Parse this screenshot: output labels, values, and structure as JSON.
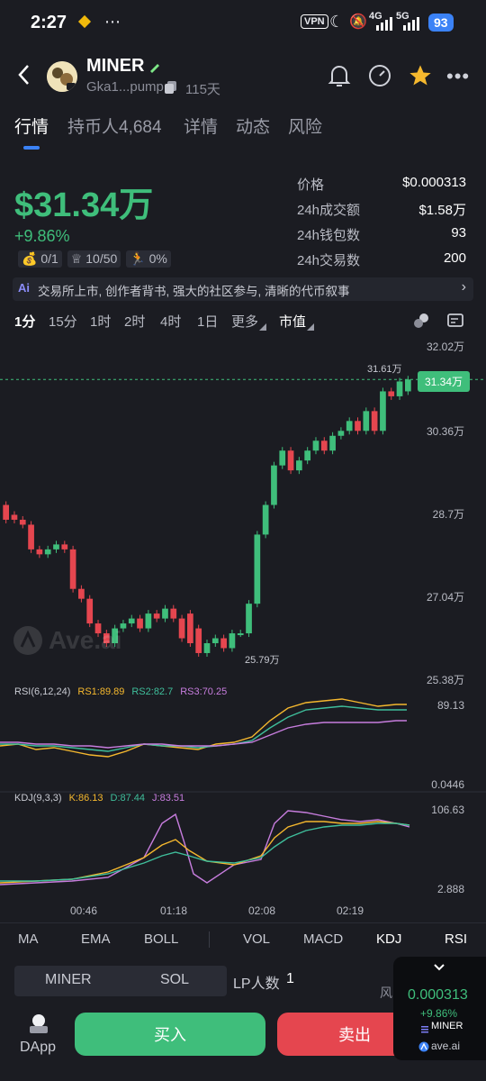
{
  "status_bar": {
    "time": "2:27",
    "vpn": "VPN",
    "signal_4g": "4G",
    "signal_5g": "5G",
    "battery": "93"
  },
  "header": {
    "title": "MINER",
    "address": "Gka1...pump",
    "age": "115天"
  },
  "tabs": [
    {
      "label": "行情"
    },
    {
      "label": "持币人4,684"
    },
    {
      "label": "详情"
    },
    {
      "label": "动态"
    },
    {
      "label": "风险"
    }
  ],
  "summary": {
    "market_cap": "$31.34万",
    "change": "+9.86%",
    "badges": [
      "0/1",
      "10/50",
      "0%"
    ],
    "stats": [
      {
        "label": "价格",
        "value": "$0.000313"
      },
      {
        "label": "24h成交额",
        "value": "$1.58万"
      },
      {
        "label": "24h钱包数",
        "value": "93"
      },
      {
        "label": "24h交易数",
        "value": "200"
      }
    ],
    "ai_text": "交易所上市, 创作者背书, 强大的社区参与, 清晰的代币叙事"
  },
  "timeframes": [
    "1分",
    "15分",
    "1时",
    "2时",
    "4时",
    "1日",
    "更多",
    "市值"
  ],
  "chart": {
    "y_ticks": [
      "32.02万",
      "30.36万",
      "28.7万",
      "27.04万",
      "25.38万"
    ],
    "current_label": "31.34万",
    "high_label": "31.61万",
    "low_label": "25.79万",
    "watermark": "Ave.ai",
    "x_ticks": [
      "00:46",
      "01:18",
      "02:08",
      "02:19"
    ],
    "rsi_label": "RSI(6,12,24)",
    "rsi_values": [
      "RS1:89.89",
      "RS2:82.7",
      "RS3:70.25"
    ],
    "rsi_axis": [
      "89.13",
      "0.0446"
    ],
    "kdj_label": "KDJ(9,3,3)",
    "kdj_values": [
      "K:86.13",
      "D:87.44",
      "J:83.51"
    ],
    "kdj_axis": [
      "106.63",
      "2.888"
    ]
  },
  "chart_data": {
    "type": "candlestick",
    "unit": "万",
    "ylim": [
      25.38,
      32.02
    ],
    "candles": [
      {
        "o": 28.8,
        "c": 28.5
      },
      {
        "o": 28.6,
        "c": 28.5
      },
      {
        "o": 28.5,
        "c": 28.4
      },
      {
        "o": 28.4,
        "c": 27.9
      },
      {
        "o": 27.9,
        "c": 27.8
      },
      {
        "o": 27.8,
        "c": 27.9
      },
      {
        "o": 27.9,
        "c": 28.0
      },
      {
        "o": 28.0,
        "c": 27.9
      },
      {
        "o": 27.9,
        "c": 27.1
      },
      {
        "o": 27.1,
        "c": 26.9
      },
      {
        "o": 26.9,
        "c": 26.4
      },
      {
        "o": 26.4,
        "c": 26.2
      },
      {
        "o": 26.2,
        "c": 26.0
      },
      {
        "o": 26.0,
        "c": 26.3
      },
      {
        "o": 26.3,
        "c": 26.4
      },
      {
        "o": 26.4,
        "c": 26.5
      },
      {
        "o": 26.5,
        "c": 26.3
      },
      {
        "o": 26.3,
        "c": 26.6
      },
      {
        "o": 26.6,
        "c": 26.5
      },
      {
        "o": 26.5,
        "c": 26.7
      },
      {
        "o": 26.7,
        "c": 26.5
      },
      {
        "o": 26.5,
        "c": 26.1
      },
      {
        "o": 26.6,
        "c": 26.0
      },
      {
        "o": 26.3,
        "c": 25.8
      },
      {
        "o": 25.8,
        "c": 26.0
      },
      {
        "o": 26.0,
        "c": 26.1
      },
      {
        "o": 26.1,
        "c": 25.9
      },
      {
        "o": 25.9,
        "c": 26.2
      },
      {
        "o": 26.2,
        "c": 26.2
      },
      {
        "o": 26.2,
        "c": 26.8
      },
      {
        "o": 26.8,
        "c": 28.2
      },
      {
        "o": 28.2,
        "c": 28.8
      },
      {
        "o": 28.8,
        "c": 29.6
      },
      {
        "o": 29.6,
        "c": 29.9
      },
      {
        "o": 29.9,
        "c": 29.5
      },
      {
        "o": 29.5,
        "c": 29.7
      },
      {
        "o": 29.7,
        "c": 29.9
      },
      {
        "o": 29.9,
        "c": 30.1
      },
      {
        "o": 30.1,
        "c": 29.9
      },
      {
        "o": 29.9,
        "c": 30.2
      },
      {
        "o": 30.2,
        "c": 30.3
      },
      {
        "o": 30.3,
        "c": 30.5
      },
      {
        "o": 30.5,
        "c": 30.3
      },
      {
        "o": 30.3,
        "c": 30.7
      },
      {
        "o": 30.7,
        "c": 30.3
      },
      {
        "o": 30.3,
        "c": 31.1
      },
      {
        "o": 31.1,
        "c": 31.0
      },
      {
        "o": 31.0,
        "c": 31.3
      },
      {
        "o": 31.1,
        "c": 31.34
      }
    ],
    "colors": {
      "up": "#3fbe7b",
      "down": "#e5464f"
    }
  },
  "indicator_tabs": [
    "MA",
    "EMA",
    "BOLL",
    "VOL",
    "MACD",
    "KDJ",
    "RSI"
  ],
  "pool": {
    "tabs": [
      "MINER",
      "SOL"
    ],
    "lp_label": "LP人数",
    "lp_count": "1",
    "risk": "风险"
  },
  "actions": {
    "dapp": "DApp",
    "buy": "买入",
    "sell": "卖出"
  },
  "widget": {
    "price": "0.000313",
    "change": "+9.86%",
    "symbol": "MINER",
    "brand": "ave.ai"
  }
}
